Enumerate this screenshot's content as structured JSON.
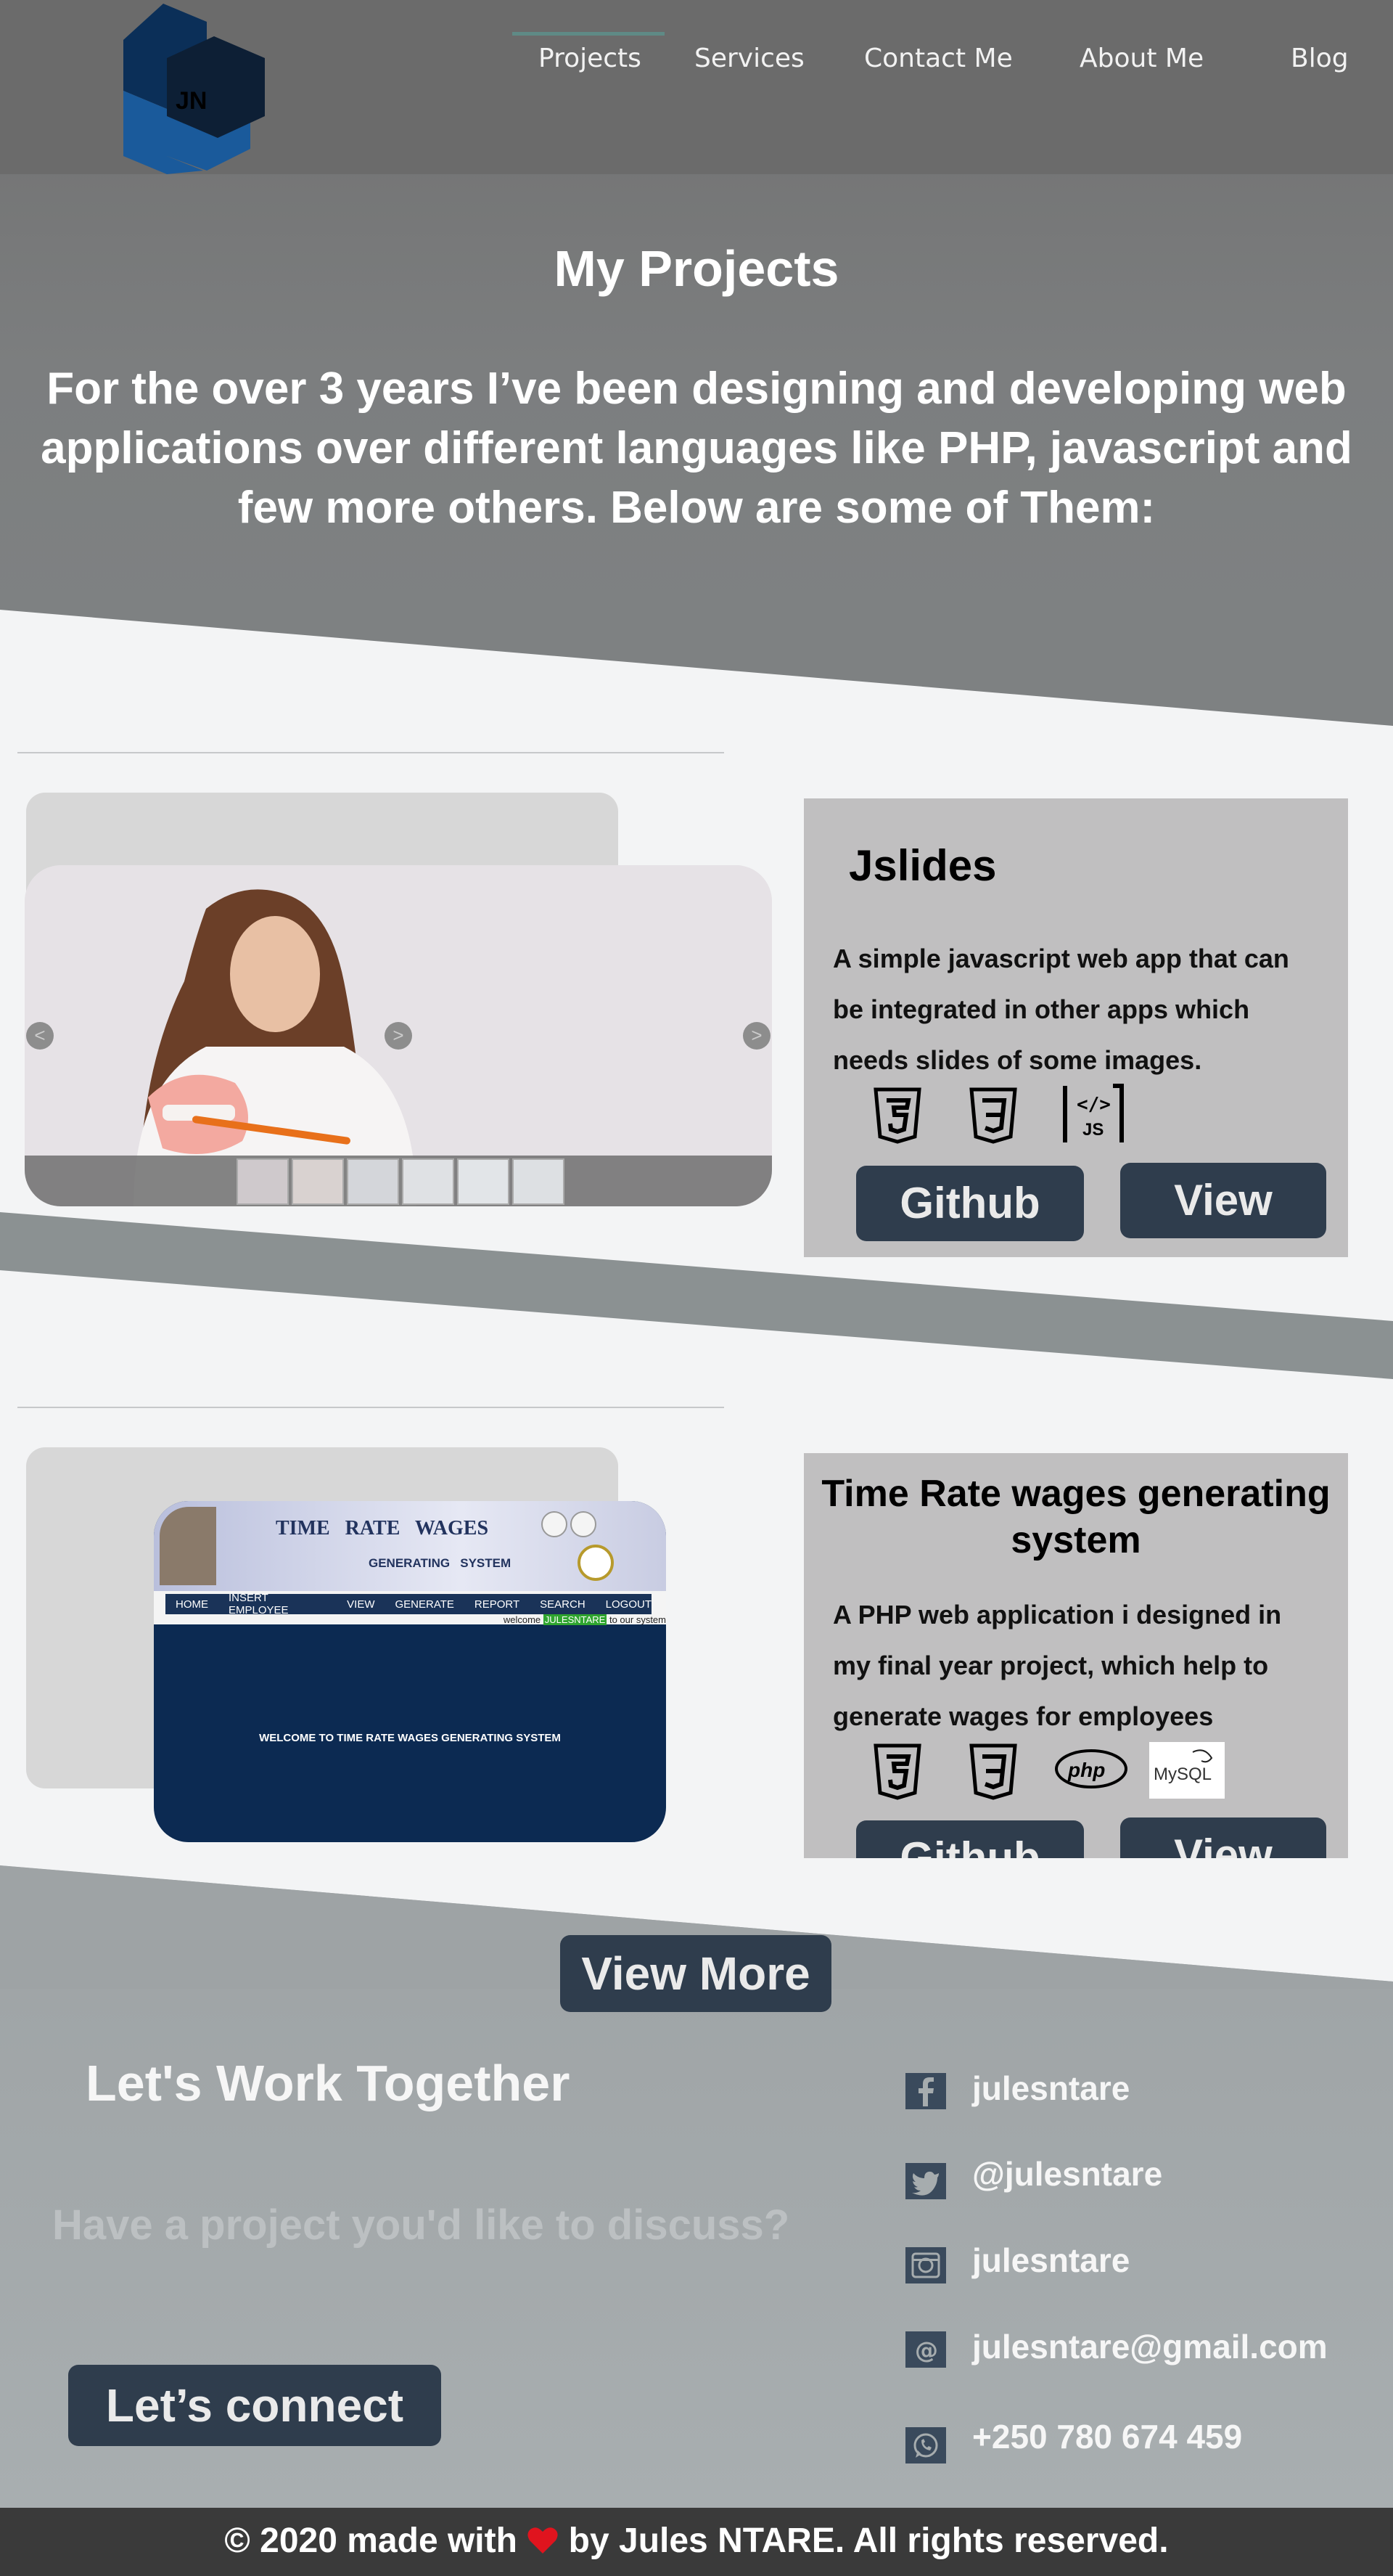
{
  "header": {
    "logo_text": "JN",
    "nav": [
      {
        "label": "Projects"
      },
      {
        "label": "Services"
      },
      {
        "label": "Contact Me"
      },
      {
        "label": "About Me"
      },
      {
        "label": "Blog"
      }
    ]
  },
  "hero": {
    "title": "My Projects",
    "text": "For the over 3 years I’ve been designing and developing web applications over different languages like PHP, javascript and few more others. Below are some of Them:"
  },
  "projects": [
    {
      "title": "Jslides",
      "description": "A simple javascript web app that can be integrated in other apps which needs slides of some images.",
      "tech_icons": [
        "html5-icon",
        "css3-icon",
        "javascript-icon"
      ],
      "js_badge": "JS",
      "github_label": "Github",
      "view_label": "View",
      "slider_prev": "<",
      "slider_next": ">"
    },
    {
      "title": "Time Rate wages generating system",
      "description": "A PHP web application i designed in my final year project, which help to generate wages for employees",
      "tech_icons": [
        "html5-icon",
        "css3-icon",
        "php-icon",
        "mysql-icon"
      ],
      "php_badge": "php",
      "mysql_badge": "MySQL",
      "github_label": "Github",
      "view_label": "View",
      "screenshot": {
        "banner_title": "TIME   RATE   WAGES",
        "banner_subtitle": "GENERATING   SYSTEM",
        "menu": [
          "HOME",
          "INSERT EMPLOYEE",
          "VIEW",
          "GENERATE",
          "REPORT",
          "SEARCH",
          "LOGOUT"
        ],
        "welcome_prefix": "welcome",
        "welcome_user": "JULESNTARE",
        "welcome_suffix": "to our system",
        "body_text": "WELCOME TO TIME RATE WAGES GENERATING SYSTEM"
      }
    }
  ],
  "view_more_label": "View More",
  "contact": {
    "title": "Let's Work Together",
    "subtitle": "Have a project you'd like to discuss?",
    "connect_label": "Let’s connect",
    "socials": [
      {
        "icon": "facebook-icon",
        "text": "julesntare"
      },
      {
        "icon": "twitter-icon",
        "text": "@julesntare"
      },
      {
        "icon": "instagram-icon",
        "text": "julesntare"
      },
      {
        "icon": "email-icon",
        "text": "julesntare@gmail.com"
      },
      {
        "icon": "whatsapp-icon",
        "text": "+250 780 674 459"
      }
    ]
  },
  "footer": {
    "prefix": "© 2020 made with",
    "suffix": "by Jules NTARE. All rights reserved."
  },
  "colors": {
    "header": "#6b6b6b",
    "button": "#2f3d4d",
    "card": "#c0bfc0",
    "footer": "#3a3a3a",
    "heart": "#e0141e"
  }
}
